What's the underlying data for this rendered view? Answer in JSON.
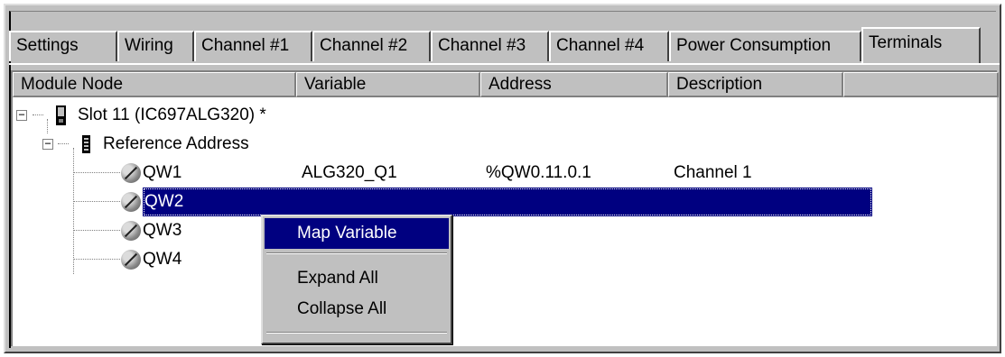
{
  "tabs": [
    {
      "label": "Settings",
      "active": false
    },
    {
      "label": "Wiring",
      "active": false
    },
    {
      "label": "Channel #1",
      "active": false
    },
    {
      "label": "Channel #2",
      "active": false
    },
    {
      "label": "Channel #3",
      "active": false
    },
    {
      "label": "Channel #4",
      "active": false
    },
    {
      "label": "Power Consumption",
      "active": false
    },
    {
      "label": "Terminals",
      "active": true
    }
  ],
  "columns": [
    "Module Node",
    "Variable",
    "Address",
    "Description"
  ],
  "tree": {
    "slot": {
      "label": "Slot 11 (IC697ALG320) *",
      "expanded": true
    },
    "ref": {
      "label": "Reference Address",
      "expanded": true
    },
    "rows": [
      {
        "node": "QW1",
        "variable": "ALG320_Q1",
        "address": "%QW0.11.0.1",
        "description": "Channel 1",
        "selected": false
      },
      {
        "node": "QW2",
        "variable": "",
        "address": "",
        "description": "",
        "selected": true
      },
      {
        "node": "QW3",
        "variable": "",
        "address": "",
        "description": "",
        "selected": false
      },
      {
        "node": "QW4",
        "variable": "",
        "address": "",
        "description": "",
        "selected": false
      }
    ]
  },
  "context_menu": {
    "items": [
      "Map Variable",
      "Expand All",
      "Collapse All"
    ],
    "highlighted": "Map Variable"
  },
  "colors": {
    "face": "#c0c0c0",
    "selection": "#000080",
    "window": "#ffffff"
  }
}
